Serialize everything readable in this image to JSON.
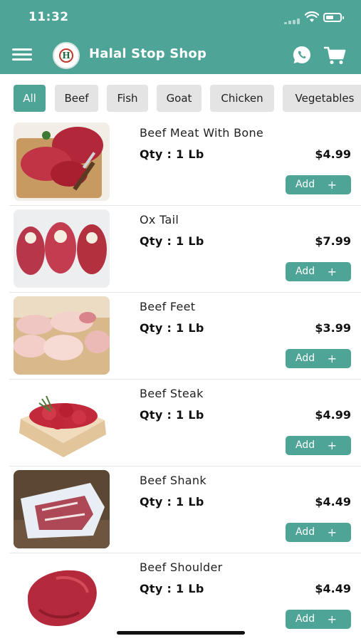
{
  "status_bar": {
    "time": "11:32"
  },
  "app_bar": {
    "title": "Halal Stop Shop",
    "logo_letter": "H"
  },
  "categories": [
    "All",
    "Beef",
    "Fish",
    "Goat",
    "Chicken",
    "Vegetables"
  ],
  "selected_category": "All",
  "products": [
    {
      "name": "Beef Meat With Bone",
      "qty": "Qty : 1 Lb",
      "price": "$4.99",
      "add_label": "Add",
      "plus": "+"
    },
    {
      "name": "Ox Tail",
      "qty": "Qty : 1 Lb",
      "price": "$7.99",
      "add_label": "Add",
      "plus": "+"
    },
    {
      "name": "Beef Feet",
      "qty": "Qty : 1 Lb",
      "price": "$3.99",
      "add_label": "Add",
      "plus": "+"
    },
    {
      "name": "Beef Steak",
      "qty": "Qty : 1 Lb",
      "price": "$4.99",
      "add_label": "Add",
      "plus": "+"
    },
    {
      "name": "Beef Shank",
      "qty": "Qty : 1 Lb",
      "price": "$4.49",
      "add_label": "Add",
      "plus": "+"
    },
    {
      "name": "Beef Shoulder",
      "qty": "Qty : 1 Lb",
      "price": "$4.49",
      "add_label": "Add",
      "plus": "+"
    }
  ],
  "colors": {
    "accent": "#4ea497",
    "chip_inactive": "#e4e4e4"
  },
  "icons": [
    "menu-icon",
    "whatsapp-icon",
    "cart-icon",
    "wifi-icon",
    "battery-icon",
    "signal-icon"
  ]
}
